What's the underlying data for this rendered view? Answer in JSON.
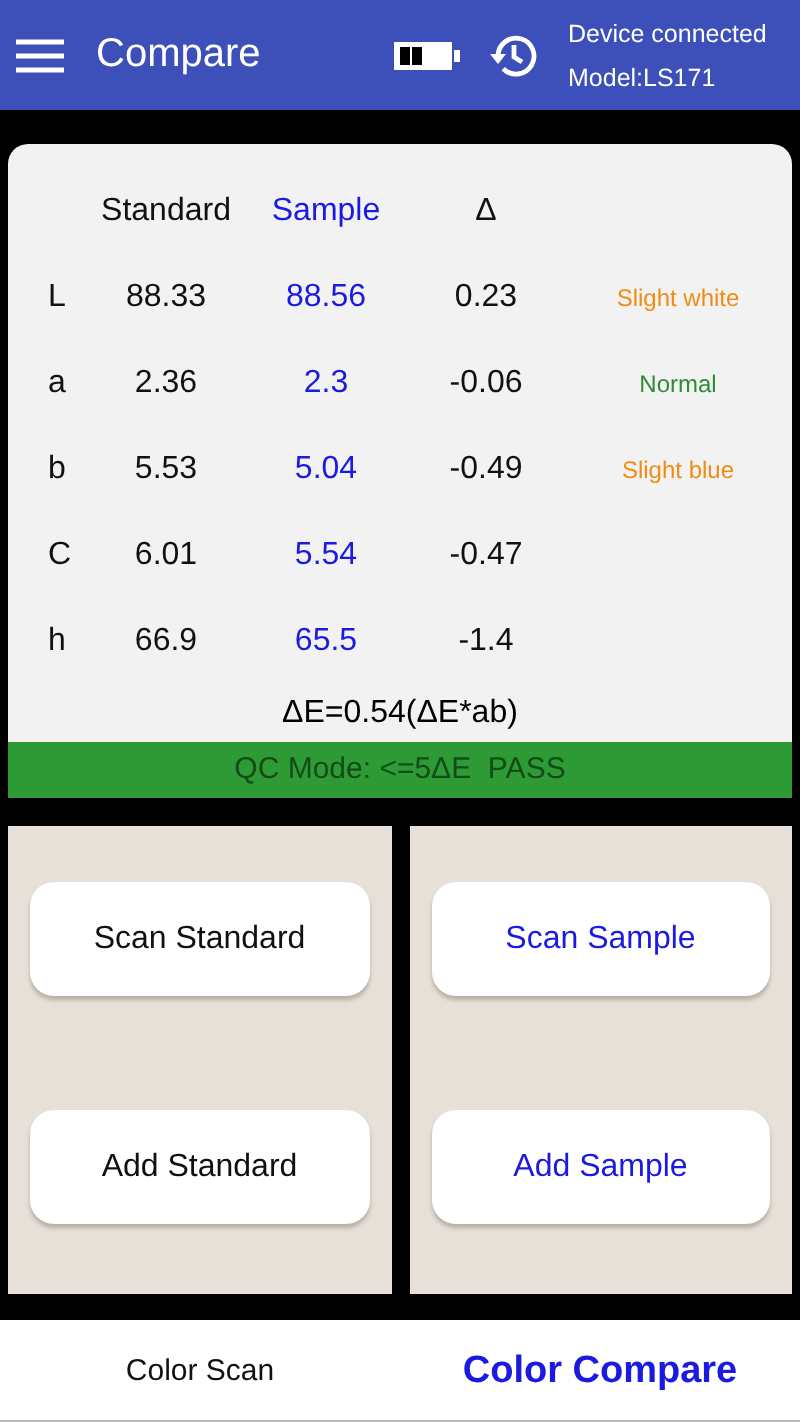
{
  "header": {
    "title": "Compare",
    "status": "Device connected",
    "model": "Model:LS171"
  },
  "table": {
    "columns": [
      "Standard",
      "Sample",
      "Δ"
    ],
    "rows": [
      {
        "label": "L",
        "standard": "88.33",
        "sample": "88.56",
        "delta": "0.23",
        "remark": "Slight white",
        "color": "#f08c14"
      },
      {
        "label": "a",
        "standard": "2.36",
        "sample": "2.3",
        "delta": "-0.06",
        "remark": "Normal",
        "color": "#2e8b36"
      },
      {
        "label": "b",
        "standard": "5.53",
        "sample": "5.04",
        "delta": "-0.49",
        "remark": "Slight blue",
        "color": "#f08c14"
      },
      {
        "label": "C",
        "standard": "6.01",
        "sample": "5.54",
        "delta": "-0.47"
      },
      {
        "label": "h",
        "standard": "66.9",
        "sample": "65.5",
        "delta": "-1.4"
      }
    ],
    "delta_e": "ΔE=0.54(ΔE*ab)",
    "qc_result": "QC Mode: <=5ΔE  PASS"
  },
  "panels": [
    {
      "kind": "standard",
      "buttons": [
        "Scan Standard",
        "Add Standard"
      ]
    },
    {
      "kind": "sample",
      "buttons": [
        "Scan Sample",
        "Add Sample"
      ]
    }
  ],
  "bottom_nav": [
    {
      "label": "Color Scan",
      "selected": false
    },
    {
      "label": "Color Compare",
      "selected": true
    }
  ]
}
